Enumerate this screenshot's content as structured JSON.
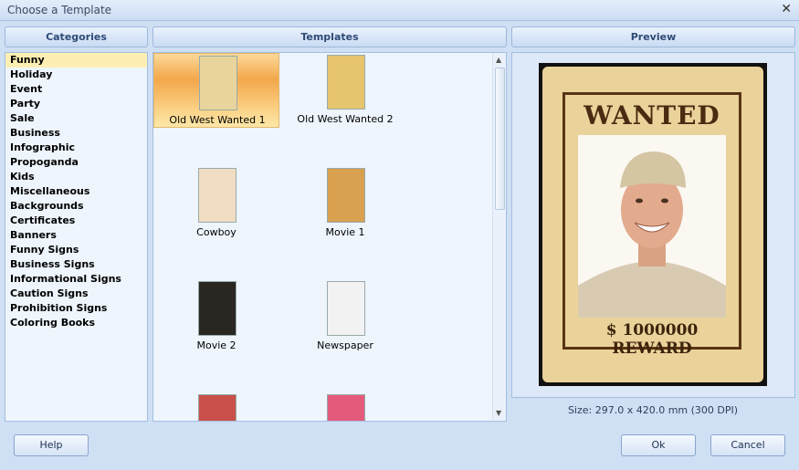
{
  "window": {
    "title": "Choose a Template",
    "close_icon": "close-icon"
  },
  "headers": {
    "categories": "Categories",
    "templates": "Templates",
    "preview": "Preview"
  },
  "categories": [
    "Funny",
    "Holiday",
    "Event",
    "Party",
    "Sale",
    "Business",
    "Infographic",
    "Propoganda",
    "Kids",
    "Miscellaneous",
    "Backgrounds",
    "Certificates",
    "Banners",
    "Funny Signs",
    "Business Signs",
    "Informational Signs",
    "Caution Signs",
    "Prohibition Signs",
    "Coloring Books"
  ],
  "selected_category": "Funny",
  "templates": [
    {
      "label": "Old West Wanted 1",
      "thumb": "#e8d49c",
      "selected": true
    },
    {
      "label": "Old West Wanted 2",
      "thumb": "#e6c56e"
    },
    {
      "label": "Cowboy",
      "thumb": "#f1dcc4"
    },
    {
      "label": "Movie 1",
      "thumb": "#d9a050"
    },
    {
      "label": "Movie 2",
      "thumb": "#2a2622"
    },
    {
      "label": "Newspaper",
      "thumb": "#f2f2f2"
    },
    {
      "label": "",
      "thumb": "#c9504a"
    },
    {
      "label": "",
      "thumb": "#e45a7a"
    }
  ],
  "preview": {
    "heading": "WANTED",
    "reward": "$ 1000000 REWARD",
    "size": "Size: 297.0 x 420.0 mm (300 DPI)"
  },
  "buttons": {
    "help": "Help",
    "ok": "Ok",
    "cancel": "Cancel"
  }
}
